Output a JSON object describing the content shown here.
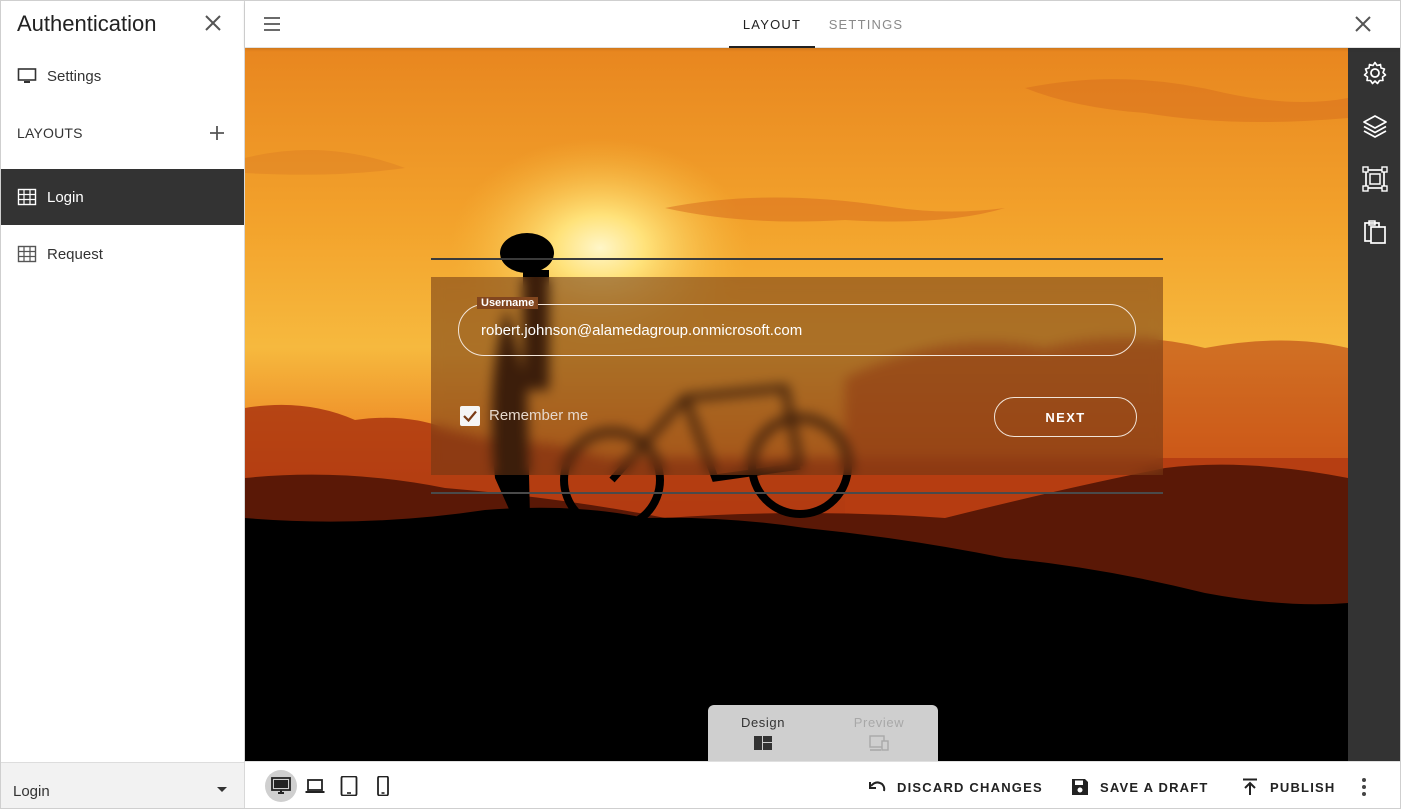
{
  "sidebar": {
    "title": "Authentication",
    "settings_label": "Settings",
    "section_label": "LAYOUTS",
    "items": [
      {
        "label": "Login",
        "active": true
      },
      {
        "label": "Request",
        "active": false
      }
    ],
    "layout_select_value": "Login"
  },
  "topbar": {
    "tabs": [
      {
        "label": "LAYOUT",
        "active": true
      },
      {
        "label": "SETTINGS",
        "active": false
      }
    ]
  },
  "login_form": {
    "username_label": "Username",
    "username_value": "robert.johnson@alamedagroup.onmicrosoft.com",
    "remember_label": "Remember me",
    "remember_checked": true,
    "next_label": "NEXT"
  },
  "mode_toggle": {
    "design_label": "Design",
    "preview_label": "Preview",
    "active": "Design"
  },
  "right_rail": {
    "icons": [
      "gear-icon",
      "layers-icon",
      "frame-select-icon",
      "clipboard-icon"
    ]
  },
  "bottombar": {
    "devices": [
      "desktop-icon",
      "laptop-icon",
      "tablet-icon",
      "phone-icon"
    ],
    "active_device": "desktop-icon",
    "discard_label": "DISCARD CHANGES",
    "save_label": "SAVE A DRAFT",
    "publish_label": "PUBLISH"
  },
  "colors": {
    "sidebar_active_bg": "#333333",
    "rail_bg": "#333333",
    "sky_top": "#f2a02a",
    "sky_mid": "#f5b63c",
    "horizon": "#e4641a"
  }
}
